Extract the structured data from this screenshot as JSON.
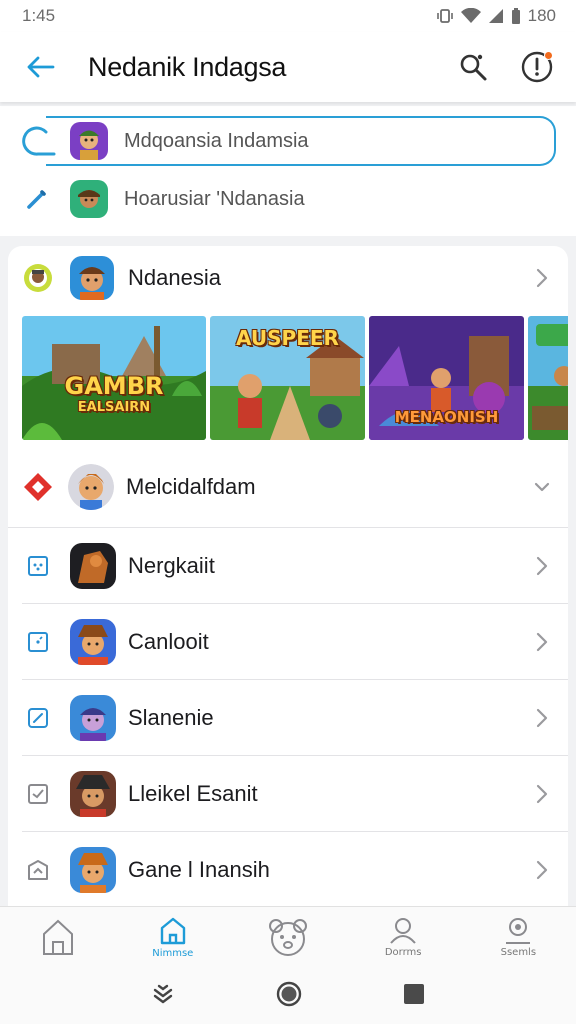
{
  "status_bar": {
    "time": "1:45",
    "battery_text": "180"
  },
  "app_bar": {
    "title": "Nedanik Indagsa",
    "back_icon": "arrow-left-icon",
    "search_icon": "search-icon",
    "alert_icon": "alert-circle-icon"
  },
  "search": {
    "active_text": "Mdqoansia Indamsia",
    "secondary_text": "Hoarusiar  'Ndanasia"
  },
  "featured": {
    "label": "Ndanesia",
    "cards": [
      {
        "title_line1": "GAMBR",
        "title_line2": "EALSAIRN"
      },
      {
        "title_line1": "AUSPEER",
        "title_line2": ""
      },
      {
        "title_line1": "MENAONISH",
        "title_line2": ""
      },
      {
        "title_line1": "",
        "title_line2": ""
      }
    ]
  },
  "list": {
    "header_label": "Melcidalfdam",
    "items": [
      {
        "label": "Nergkaiit"
      },
      {
        "label": "Canlooit"
      },
      {
        "label": "Slanenie"
      },
      {
        "label": "Lleikel Esanit"
      },
      {
        "label": "Gane l Inansih"
      }
    ]
  },
  "bottom_nav": {
    "items": [
      {
        "label": ""
      },
      {
        "label": "Nimmse"
      },
      {
        "label": ""
      },
      {
        "label": "Dorrms"
      },
      {
        "label": "Ssemls"
      }
    ]
  },
  "colors": {
    "accent": "#1d9bd7",
    "orange": "#f26b1d",
    "red": "#e0312b"
  }
}
